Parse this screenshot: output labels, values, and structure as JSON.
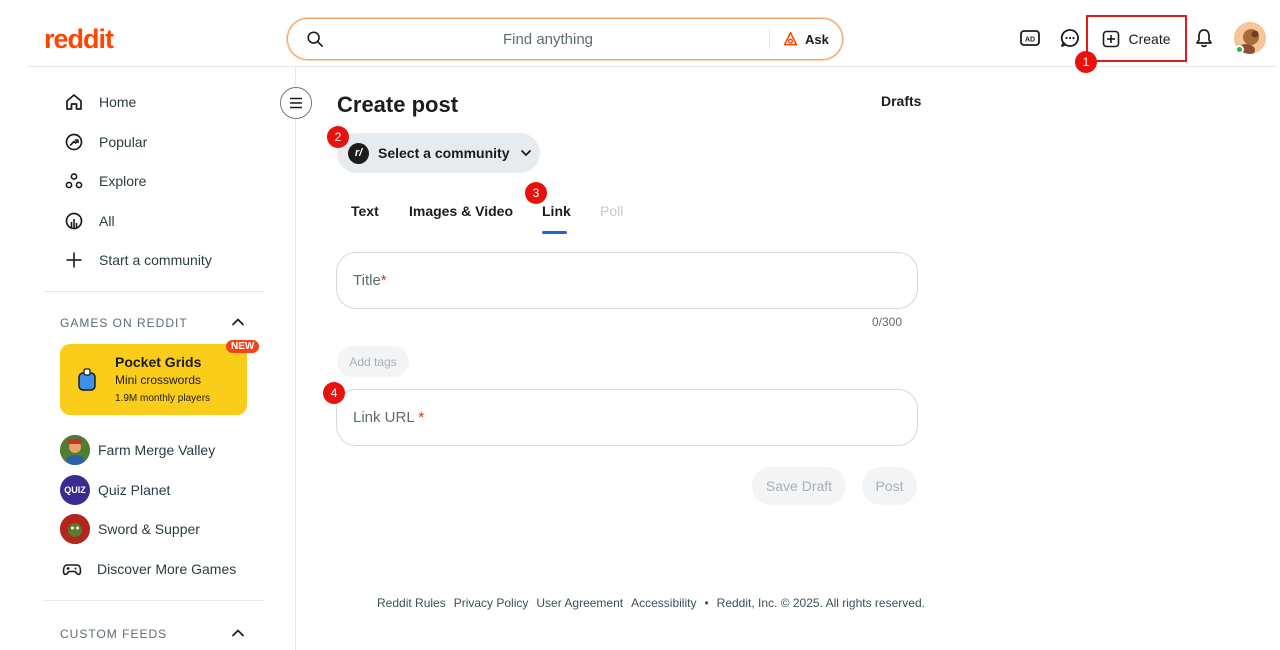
{
  "header": {
    "logo": "reddit",
    "search": {
      "placeholder": "Find anything",
      "ask_label": "Ask"
    },
    "create_label": "Create"
  },
  "annotations": {
    "b1": "1",
    "b2": "2",
    "b3": "3",
    "b4": "4"
  },
  "sidebar": {
    "nav": [
      {
        "label": "Home"
      },
      {
        "label": "Popular"
      },
      {
        "label": "Explore"
      },
      {
        "label": "All"
      },
      {
        "label": "Start a community"
      }
    ],
    "games_section": "GAMES ON REDDIT",
    "promo": {
      "badge": "NEW",
      "title": "Pocket Grids",
      "subtitle": "Mini crosswords",
      "players": "1.9M monthly players"
    },
    "games": [
      {
        "label": "Farm Merge Valley"
      },
      {
        "label": "Quiz Planet",
        "thumb_text": "QUIZ"
      },
      {
        "label": "Sword & Supper"
      },
      {
        "label": "Discover More Games"
      }
    ],
    "custom_feeds": "CUSTOM FEEDS"
  },
  "main": {
    "title": "Create post",
    "drafts": "Drafts",
    "community": {
      "icon_text": "r/",
      "label": "Select a community"
    },
    "tabs": [
      {
        "label": "Text"
      },
      {
        "label": "Images & Video"
      },
      {
        "label": "Link"
      },
      {
        "label": "Poll"
      }
    ],
    "title_field": {
      "label": "Title",
      "required_mark": "*",
      "count": "0/300"
    },
    "add_tags": "Add tags",
    "link_field": {
      "label": "Link URL",
      "required_mark": "*"
    },
    "save_draft": "Save Draft",
    "post": "Post"
  },
  "footer": {
    "links": [
      "Reddit Rules",
      "Privacy Policy",
      "User Agreement",
      "Accessibility"
    ],
    "separator": "•",
    "copyright": "Reddit, Inc. © 2025. All rights reserved."
  }
}
